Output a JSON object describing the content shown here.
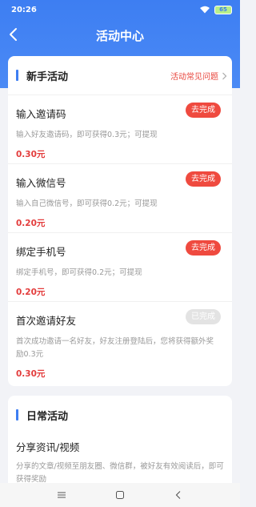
{
  "status": {
    "time": "20:26",
    "battery": "65"
  },
  "header": {
    "title": "活动中心"
  },
  "newbie": {
    "title": "新手活动",
    "faq_label": "活动常见问题",
    "tasks": [
      {
        "title": "输入邀请码",
        "desc": "输入好友邀请码，即可获得0.3元；可提现",
        "reward": "0.30元",
        "button": "去完成"
      },
      {
        "title": "输入微信号",
        "desc": "输入自己微信号，即可获得0.2元；可提现",
        "reward": "0.20元",
        "button": "去完成"
      },
      {
        "title": "绑定手机号",
        "desc": "绑定手机号，即可获得0.2元；可提现",
        "reward": "0.20元",
        "button": "去完成"
      },
      {
        "title": "首次邀请好友",
        "desc": "首次成功邀请一名好友，好友注册登陆后，您将获得额外奖励0.3元",
        "reward": "0.30元",
        "button": "已完成"
      }
    ]
  },
  "daily": {
    "title": "日常活动",
    "tasks": [
      {
        "title": "分享资讯/视频",
        "desc": "分享的文章/视频至朋友圈、微信群，被好友有效阅读后，即可获得奖励"
      }
    ]
  },
  "colors": {
    "accent": "#3d7ef2",
    "action": "#ef4a3f",
    "reward": "#e33c3c"
  },
  "icons": [
    "back-icon",
    "wifi-icon",
    "battery-icon",
    "chevron-right-icon",
    "menu-icon",
    "home-icon",
    "back-nav-icon"
  ]
}
